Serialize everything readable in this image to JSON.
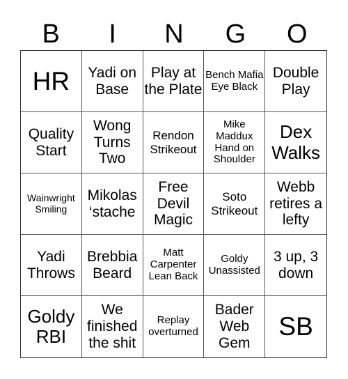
{
  "header": {
    "letters": [
      "B",
      "I",
      "N",
      "G",
      "O"
    ]
  },
  "cells": [
    [
      "HR",
      "Yadi on Base",
      "Play at the Plate",
      "Bench Mafia Eye Black",
      "Double Play"
    ],
    [
      "Quality Start",
      "Wong Turns Two",
      "Rendon Strikeout",
      "Mike Maddux Hand on Shoulder",
      "Dex Walks"
    ],
    [
      "Wainwright Smiling",
      "Mikolas ‘stache",
      "Free Devil Magic",
      "Soto Strikeout",
      "Webb retires a lefty"
    ],
    [
      "Yadi Throws",
      "Brebbia Beard",
      "Matt Carpenter Lean Back",
      "Goldy Unassisted",
      "3 up, 3 down"
    ],
    [
      "Goldy RBI",
      "We finished the shit",
      "Replay overturned",
      "Bader Web Gem",
      "SB"
    ]
  ]
}
